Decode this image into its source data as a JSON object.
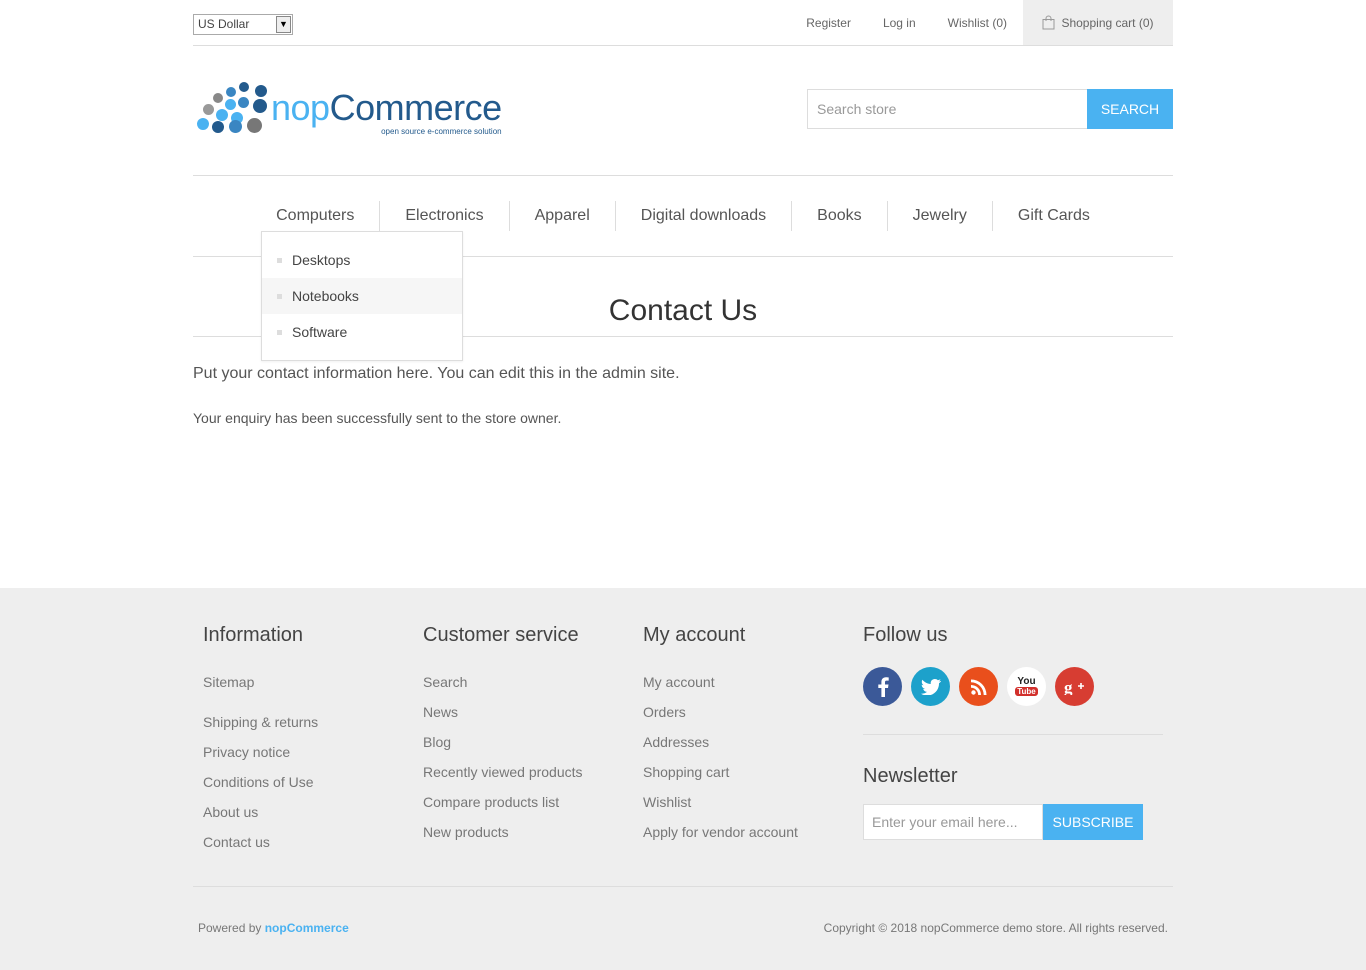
{
  "header": {
    "currency": "US Dollar",
    "links": {
      "register": "Register",
      "login": "Log in",
      "wishlist": "Wishlist",
      "wishlist_count": "(0)",
      "cart": "Shopping cart",
      "cart_count": "(0)"
    },
    "logo": {
      "brand_prefix": "nop",
      "brand_suffix": "Commerce",
      "tagline": "open source e-commerce solution"
    },
    "search": {
      "placeholder": "Search store",
      "button": "Search"
    }
  },
  "menu": {
    "items": [
      "Computers",
      "Electronics",
      "Apparel",
      "Digital downloads",
      "Books",
      "Jewelry",
      "Gift Cards"
    ],
    "dropdown": [
      "Desktops",
      "Notebooks",
      "Software"
    ]
  },
  "content": {
    "title": "Contact Us",
    "topic": "Put your contact information here. You can edit this in the admin site.",
    "result": "Your enquiry has been successfully sent to the store owner."
  },
  "footer": {
    "information": {
      "title": "Information",
      "links": [
        "Sitemap",
        "Shipping & returns",
        "Privacy notice",
        "Conditions of Use",
        "About us",
        "Contact us"
      ]
    },
    "customer_service": {
      "title": "Customer service",
      "links": [
        "Search",
        "News",
        "Blog",
        "Recently viewed products",
        "Compare products list",
        "New products"
      ]
    },
    "my_account": {
      "title": "My account",
      "links": [
        "My account",
        "Orders",
        "Addresses",
        "Shopping cart",
        "Wishlist",
        "Apply for vendor account"
      ]
    },
    "follow": {
      "title": "Follow us",
      "icons": [
        "facebook-icon",
        "twitter-icon",
        "rss-icon",
        "youtube-icon",
        "google-plus-icon"
      ],
      "youtube_label_top": "You",
      "youtube_label_bottom": "Tube"
    },
    "newsletter": {
      "title": "Newsletter",
      "placeholder": "Enter your email here...",
      "button": "Subscribe"
    },
    "powered_prefix": "Powered by",
    "powered_link": "nopCommerce",
    "copyright": "Copyright © 2018 nopCommerce demo store. All rights reserved."
  },
  "colors": {
    "accent": "#4ab2f1",
    "facebook": "#3b5998",
    "twitter": "#1da1cb",
    "rss": "#e94f1c",
    "youtube": "#ffffff",
    "google_plus": "#d73d32"
  }
}
